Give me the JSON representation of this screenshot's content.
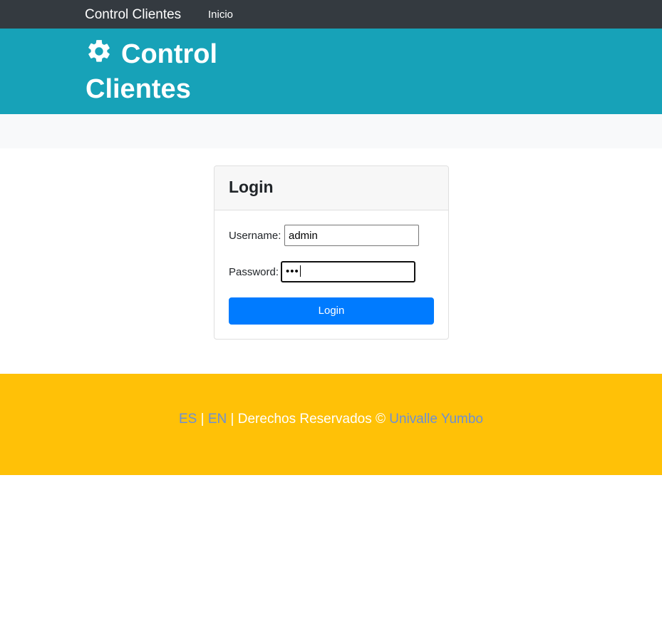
{
  "navbar": {
    "brand": "Control Clientes",
    "links": [
      {
        "label": "Inicio"
      }
    ]
  },
  "hero": {
    "title": "Control Clientes",
    "icon": "gear-icon"
  },
  "login_card": {
    "title": "Login",
    "username_label": "Username:",
    "username_value": "admin",
    "password_label": "Password:",
    "password_value": "•••",
    "submit_label": "Login"
  },
  "footer": {
    "lang_es": "ES",
    "sep1": " | ",
    "lang_en": "EN",
    "rights_text": " | Derechos Reservados © ",
    "org_link": "Univalle Yumbo"
  },
  "colors": {
    "navbar_bg": "#343a40",
    "hero_bg": "#17a2b8",
    "button_bg": "#007bff",
    "footer_bg": "#ffc107",
    "link": "#6c8fd6"
  }
}
